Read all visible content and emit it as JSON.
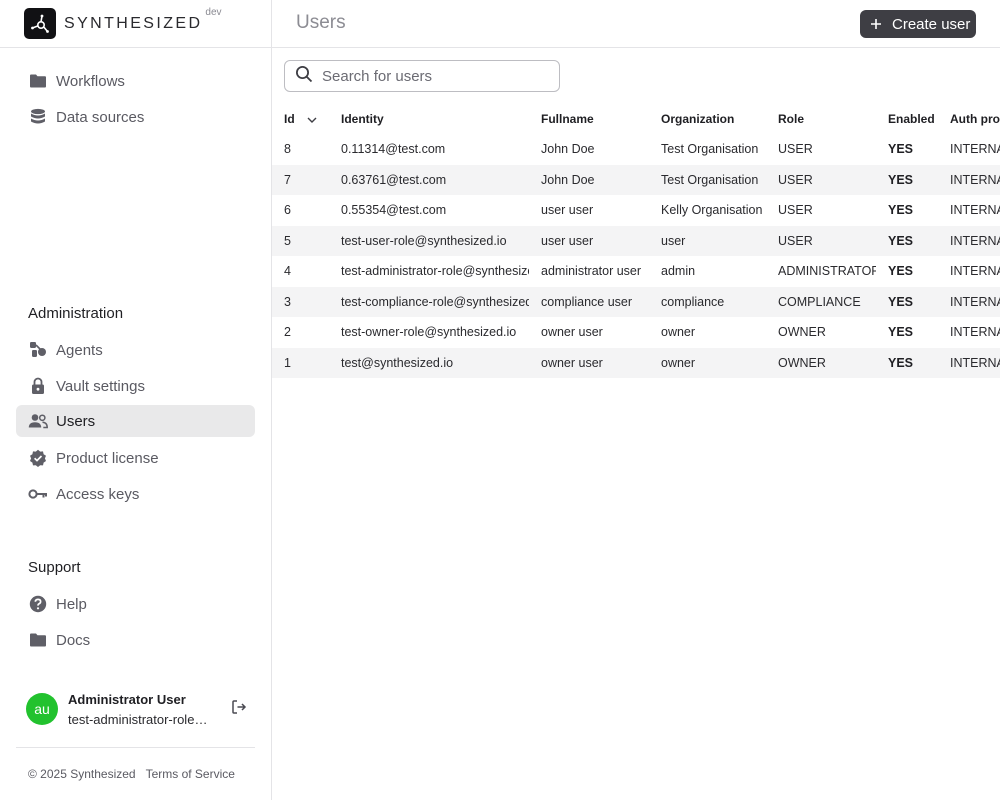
{
  "brand": {
    "name": "SYNTHESIZED",
    "tag": "dev"
  },
  "sidebar": {
    "main_items": [
      {
        "label": "Workflows",
        "icon": "folder-icon"
      },
      {
        "label": "Data sources",
        "icon": "database-icon"
      }
    ],
    "administration": {
      "title": "Administration",
      "items": [
        {
          "label": "Agents",
          "icon": "agents-icon"
        },
        {
          "label": "Vault settings",
          "icon": "lock-icon"
        },
        {
          "label": "Users",
          "icon": "users-icon",
          "active": true
        },
        {
          "label": "Product license",
          "icon": "verified-badge-icon"
        },
        {
          "label": "Access keys",
          "icon": "key-icon"
        }
      ]
    },
    "support": {
      "title": "Support",
      "items": [
        {
          "label": "Help",
          "icon": "help-icon"
        },
        {
          "label": "Docs",
          "icon": "folder-icon"
        }
      ]
    },
    "user": {
      "initials": "au",
      "name": "Administrator User",
      "email": "test-administrator-role@synthesized.io",
      "avatar_color": "#22c22e"
    },
    "footer": {
      "copyright": "© 2025 Synthesized",
      "terms": "Terms of Service"
    }
  },
  "header": {
    "title": "Users",
    "create_button": "Create user"
  },
  "search": {
    "placeholder": "Search for users",
    "value": ""
  },
  "table": {
    "columns": [
      "Id",
      "Identity",
      "Fullname",
      "Organization",
      "Role",
      "Enabled",
      "Auth provider"
    ],
    "rows": [
      [
        "8",
        "0.11314@test.com",
        "John Doe",
        "Test Organisation",
        "USER",
        "YES",
        "INTERNAL"
      ],
      [
        "7",
        "0.63761@test.com",
        "John Doe",
        "Test Organisation",
        "USER",
        "YES",
        "INTERNAL"
      ],
      [
        "6",
        "0.55354@test.com",
        "user user",
        "Kelly Organisation",
        "USER",
        "YES",
        "INTERNAL"
      ],
      [
        "5",
        "test-user-role@synthesized.io",
        "user user",
        "user",
        "USER",
        "YES",
        "INTERNAL"
      ],
      [
        "4",
        "test-administrator-role@synthesized.io",
        "administrator user",
        "admin",
        "ADMINISTRATOR",
        "YES",
        "INTERNAL"
      ],
      [
        "3",
        "test-compliance-role@synthesized.io",
        "compliance user",
        "compliance",
        "COMPLIANCE",
        "YES",
        "INTERNAL"
      ],
      [
        "2",
        "test-owner-role@synthesized.io",
        "owner user",
        "owner",
        "OWNER",
        "YES",
        "INTERNAL"
      ],
      [
        "1",
        "test@synthesized.io",
        "owner user",
        "owner",
        "OWNER",
        "YES",
        "INTERNAL"
      ]
    ]
  },
  "colors": {
    "accent": "#3e3e44",
    "active_bg": "#e9e9ea",
    "stripe": "#f4f4f5"
  }
}
